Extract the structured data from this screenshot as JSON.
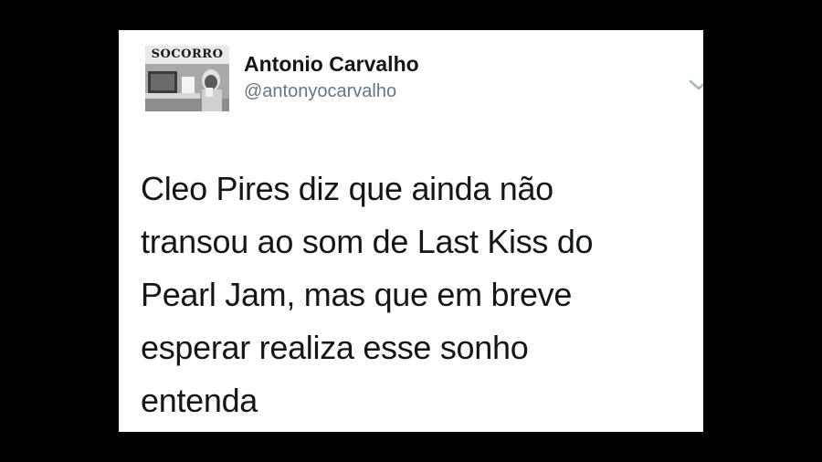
{
  "tweet": {
    "avatar": {
      "caption": "SOCORRO"
    },
    "author": {
      "display_name": "Antonio Carvalho",
      "handle": "@antonyocarvalho"
    },
    "menu_icon": "chevron-down-icon",
    "text": "Cleo Pires diz que ainda não\ntransou ao som de Last Kiss do\nPearl Jam, mas que em breve\nesperar realiza esse sonho\nentenda"
  },
  "colors": {
    "background": "#000000",
    "card": "#ffffff",
    "text": "#14171a",
    "handle": "#657786",
    "chevron": "#aab8c2"
  }
}
